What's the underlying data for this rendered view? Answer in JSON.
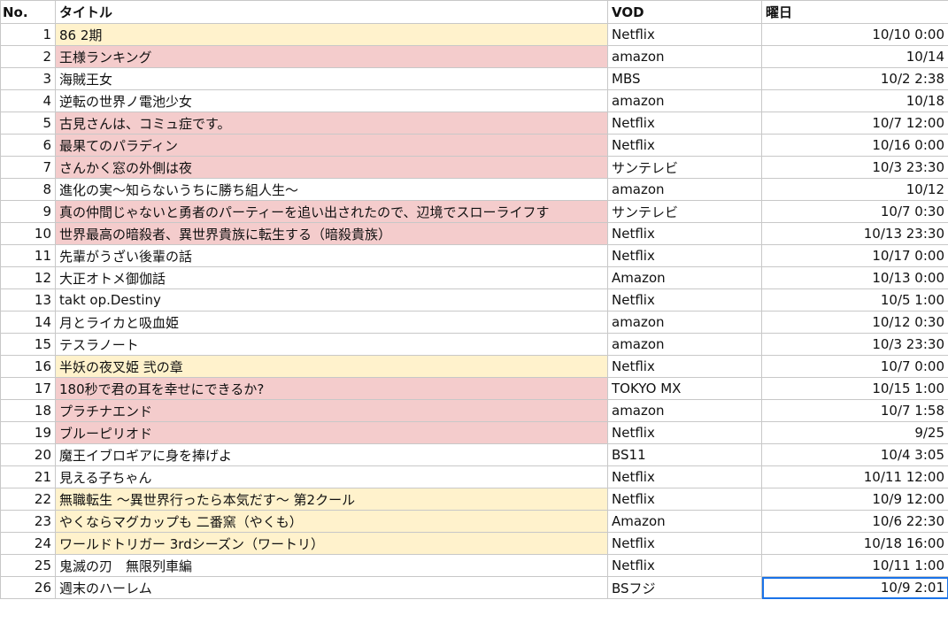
{
  "headers": {
    "no": "No.",
    "title": "タイトル",
    "vod": "VOD",
    "day": "曜日"
  },
  "colors": {
    "yellow": "#fff2cc",
    "pink": "#f4cccc",
    "selection": "#1a73e8"
  },
  "rows": [
    {
      "no": "1",
      "title": "86 2期",
      "vod": "Netflix",
      "time": "10/10 0:00",
      "hl": "yellow"
    },
    {
      "no": "2",
      "title": "王様ランキング",
      "vod": "amazon",
      "time": "10/14",
      "hl": "pink"
    },
    {
      "no": "3",
      "title": "海賊王女",
      "vod": "MBS",
      "time": "10/2 2:38",
      "hl": ""
    },
    {
      "no": "4",
      "title": "逆転の世界ノ電池少女",
      "vod": "amazon",
      "time": "10/18",
      "hl": ""
    },
    {
      "no": "5",
      "title": "古見さんは、コミュ症です。",
      "vod": "Netflix",
      "time": "10/7 12:00",
      "hl": "pink"
    },
    {
      "no": "6",
      "title": "最果てのパラディン",
      "vod": "Netflix",
      "time": "10/16 0:00",
      "hl": "pink"
    },
    {
      "no": "7",
      "title": "さんかく窓の外側は夜",
      "vod": "サンテレビ",
      "time": "10/3 23:30",
      "hl": "pink"
    },
    {
      "no": "8",
      "title": "進化の実～知らないうちに勝ち組人生～",
      "vod": "amazon",
      "time": "10/12",
      "hl": ""
    },
    {
      "no": "9",
      "title": "真の仲間じゃないと勇者のパーティーを追い出されたので、辺境でスローライフす",
      "vod": "サンテレビ",
      "time": "10/7 0:30",
      "hl": "pink"
    },
    {
      "no": "10",
      "title": "世界最高の暗殺者、異世界貴族に転生する（暗殺貴族）",
      "vod": "Netflix",
      "time": "10/13 23:30",
      "hl": "pink"
    },
    {
      "no": "11",
      "title": "先輩がうざい後輩の話",
      "vod": "Netflix",
      "time": "10/17 0:00",
      "hl": ""
    },
    {
      "no": "12",
      "title": "大正オトメ御伽話",
      "vod": "Amazon",
      "time": "10/13 0:00",
      "hl": ""
    },
    {
      "no": "13",
      "title": "takt op.Destiny",
      "vod": "Netflix",
      "time": "10/5 1:00",
      "hl": ""
    },
    {
      "no": "14",
      "title": "月とライカと吸血姫",
      "vod": "amazon",
      "time": "10/12 0:30",
      "hl": ""
    },
    {
      "no": "15",
      "title": "テスラノート",
      "vod": "amazon",
      "time": "10/3 23:30",
      "hl": ""
    },
    {
      "no": "16",
      "title": "半妖の夜叉姫 弐の章",
      "vod": "Netflix",
      "time": "10/7 0:00",
      "hl": "yellow"
    },
    {
      "no": "17",
      "title": "180秒で君の耳を幸せにできるか?",
      "vod": "TOKYO MX",
      "time": "10/15 1:00",
      "hl": "pink"
    },
    {
      "no": "18",
      "title": "プラチナエンド",
      "vod": "amazon",
      "time": "10/7 1:58",
      "hl": "pink"
    },
    {
      "no": "19",
      "title": "ブルーピリオド",
      "vod": "Netflix",
      "time": "9/25",
      "hl": "pink"
    },
    {
      "no": "20",
      "title": "魔王イブロギアに身を捧げよ",
      "vod": "BS11",
      "time": "10/4 3:05",
      "hl": ""
    },
    {
      "no": "21",
      "title": "見える子ちゃん",
      "vod": "Netflix",
      "time": "10/11 12:00",
      "hl": ""
    },
    {
      "no": "22",
      "title": "無職転生 ～異世界行ったら本気だす～ 第2クール",
      "vod": "Netflix",
      "time": "10/9 12:00",
      "hl": "yellow"
    },
    {
      "no": "23",
      "title": "やくならマグカップも 二番窯（やくも）",
      "vod": "Amazon",
      "time": "10/6 22:30",
      "hl": "yellow"
    },
    {
      "no": "24",
      "title": "ワールドトリガー 3rdシーズン（ワートリ）",
      "vod": "Netflix",
      "time": "10/18 16:00",
      "hl": "yellow"
    },
    {
      "no": "25",
      "title": "鬼滅の刃　無限列車編",
      "vod": "Netflix",
      "time": "10/11 1:00",
      "hl": ""
    },
    {
      "no": "26",
      "title": "週末のハーレム",
      "vod": "BSフジ",
      "time": "10/9 2:01",
      "hl": "",
      "selected": true
    }
  ]
}
